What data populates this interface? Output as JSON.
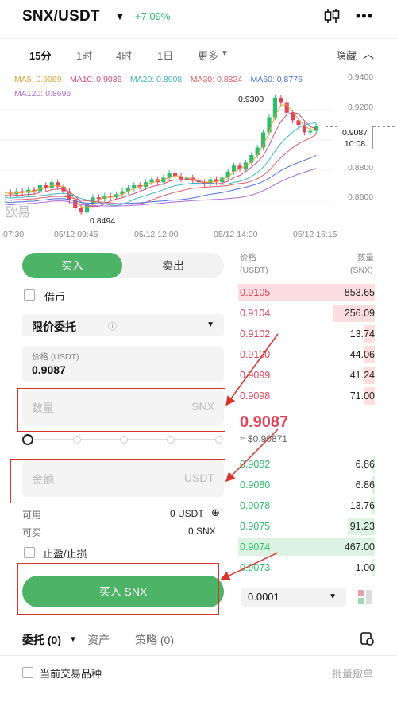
{
  "header": {
    "pair": "SNX/USDT",
    "change": "+7.09%"
  },
  "timeframes": [
    {
      "label": "15分",
      "active": true
    },
    {
      "label": "1时",
      "active": false
    },
    {
      "label": "4时",
      "active": false
    },
    {
      "label": "1日",
      "active": false
    },
    {
      "label": "更多",
      "active": false
    }
  ],
  "hide_label": "隐藏",
  "chart": {
    "ma_row1": [
      {
        "label": "MA5: 0.9069",
        "color": "#e8a23a"
      },
      {
        "label": "MA10: 0.9036",
        "color": "#d7497a"
      },
      {
        "label": "MA20: 0.8908",
        "color": "#3fb6c4"
      },
      {
        "label": "MA30: 0.8824",
        "color": "#e05a66"
      },
      {
        "label": "MA60: 0.8776",
        "color": "#4c6fe0"
      }
    ],
    "ma_row2": [
      {
        "label": "MA120: 0.8696",
        "color": "#b06ad8"
      }
    ],
    "y_ticks": [
      "0.9400",
      "0.9200",
      "0.9000",
      "0.8800",
      "0.8600"
    ],
    "x_ticks": [
      "07:30",
      "05/12 09:45",
      "05/12 12:00",
      "05/12 14:00",
      "05/12 16:15"
    ],
    "high_label": "0.9300",
    "low_label": "0.8494",
    "last_price": "0.9087",
    "countdown": "10:08",
    "watermark": "欧易"
  },
  "chart_data": {
    "type": "candlestick",
    "x_start": "07:30",
    "x_end": "05/12 16:15",
    "ylim": [
      0.84,
      0.94
    ],
    "high": 0.93,
    "low": 0.8494,
    "last": 0.9087
  },
  "trade": {
    "buy_tab": "买入",
    "sell_tab": "卖出",
    "borrow_label": "借币",
    "order_type": "限价委托",
    "price_label": "价格 (USDT)",
    "price_value": "0.9087",
    "qty_placeholder": "数量",
    "qty_unit": "SNX",
    "amount_placeholder": "金额",
    "amount_unit": "USDT",
    "available_label": "可用",
    "available_value": "0 USDT",
    "can_buy_label": "可买",
    "can_buy_value": "0 SNX",
    "tpsl_label": "止盈/止损",
    "buy_button": "买入 SNX"
  },
  "orderbook": {
    "price_header": "价格",
    "price_unit": "(USDT)",
    "qty_header": "数量",
    "qty_unit": "(SNX)",
    "asks": [
      {
        "price": "0.9105",
        "qty": "853.65",
        "depth": 1.0
      },
      {
        "price": "0.9104",
        "qty": "256.09",
        "depth": 0.3
      },
      {
        "price": "0.9102",
        "qty": "13.74",
        "depth": 0.08
      },
      {
        "price": "0.9100",
        "qty": "44.06",
        "depth": 0.08
      },
      {
        "price": "0.9099",
        "qty": "41.24",
        "depth": 0.08
      },
      {
        "price": "0.9098",
        "qty": "71.00",
        "depth": 0.08
      }
    ],
    "mid_price": "0.9087",
    "mid_usd": "≈ $0.90871",
    "bids": [
      {
        "price": "0.9082",
        "qty": "6.86",
        "depth": 0.02
      },
      {
        "price": "0.9080",
        "qty": "6.86",
        "depth": 0.02
      },
      {
        "price": "0.9078",
        "qty": "13.76",
        "depth": 0.03
      },
      {
        "price": "0.9075",
        "qty": "91.23",
        "depth": 0.2
      },
      {
        "price": "0.9074",
        "qty": "467.00",
        "depth": 1.0
      },
      {
        "price": "0.9073",
        "qty": "1.00",
        "depth": 0.01
      }
    ],
    "precision": "0.0001"
  },
  "bottom": {
    "orders_tab": "委托 (0)",
    "assets_tab": "资产",
    "strategy_tab": "策略 (0)",
    "current_pair_label": "当前交易品种",
    "batch_cancel": "批量撤单"
  }
}
